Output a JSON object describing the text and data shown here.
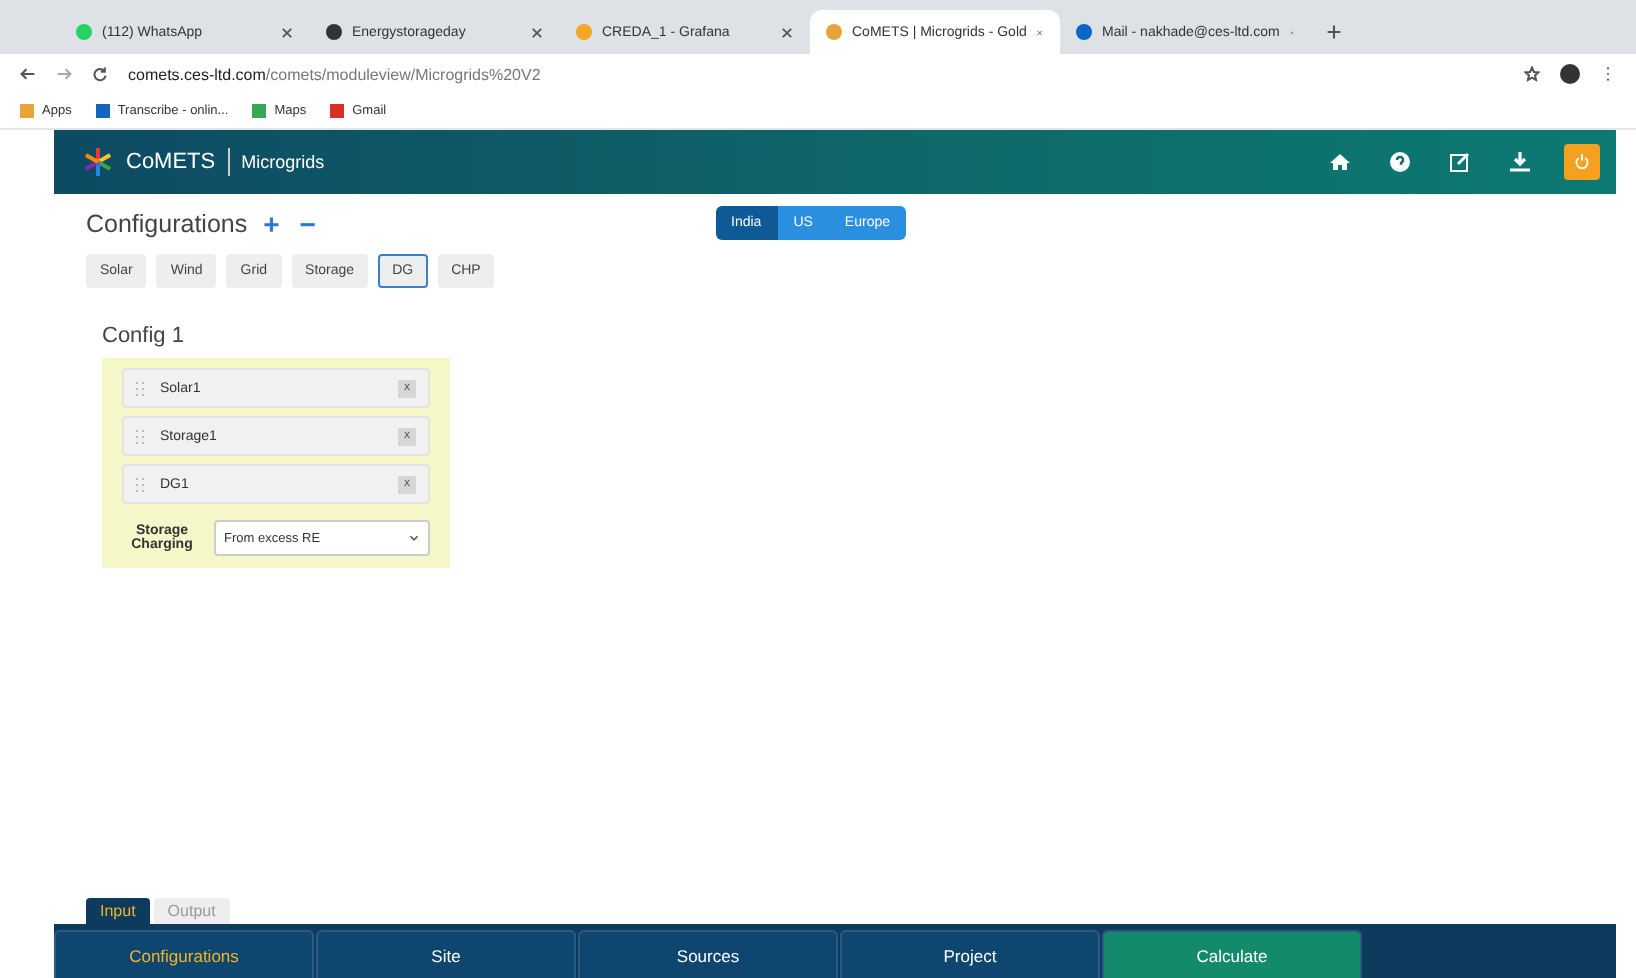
{
  "browser": {
    "tabs": [
      {
        "title": "(112) WhatsApp",
        "selected": false,
        "color": "#25d366"
      },
      {
        "title": "Energystorageday",
        "selected": false,
        "color": "#333333"
      },
      {
        "title": "CREDA_1 - Grafana",
        "selected": false,
        "color": "#f5a623"
      },
      {
        "title": "CoMETS | Microgrids - Gold",
        "selected": true,
        "color": "#e8a33a"
      },
      {
        "title": "Mail - nakhade@ces-ltd.com",
        "selected": false,
        "color": "#0a66c2"
      }
    ],
    "address": {
      "host": "comets.ces-ltd.com",
      "path": "/comets/moduleview/Microgrids%20V2"
    },
    "bookmarks": [
      {
        "label": "Apps",
        "color": "#e8a33a"
      },
      {
        "label": "Transcribe - onlin...",
        "color": "#1565c0"
      },
      {
        "label": "Maps",
        "color": "#34a853"
      },
      {
        "label": "Gmail",
        "color": "#d93025"
      }
    ]
  },
  "header": {
    "brand": "CoMETS",
    "product": "Microgrids"
  },
  "configurations": {
    "title": "Configurations",
    "add": "+",
    "remove": "−"
  },
  "regions": [
    {
      "label": "India",
      "selected": true
    },
    {
      "label": "US",
      "selected": false
    },
    {
      "label": "Europe",
      "selected": false
    }
  ],
  "components": [
    {
      "label": "Solar",
      "selected": false
    },
    {
      "label": "Wind",
      "selected": false
    },
    {
      "label": "Grid",
      "selected": false
    },
    {
      "label": "Storage",
      "selected": false
    },
    {
      "label": "DG",
      "selected": true
    },
    {
      "label": "CHP",
      "selected": false
    }
  ],
  "config": {
    "title": "Config 1",
    "items": [
      {
        "label": "Solar1",
        "remove": "x"
      },
      {
        "label": "Storage1",
        "remove": "x"
      },
      {
        "label": "DG1",
        "remove": "x"
      }
    ],
    "storage_label": "Storage Charging",
    "storage_value": "From excess RE"
  },
  "io_tabs": [
    {
      "label": "Input",
      "selected": true
    },
    {
      "label": "Output",
      "selected": false
    }
  ],
  "nav": [
    {
      "label": "Configurations",
      "selected": true,
      "kind": "tab"
    },
    {
      "label": "Site",
      "selected": false,
      "kind": "tab"
    },
    {
      "label": "Sources",
      "selected": false,
      "kind": "tab"
    },
    {
      "label": "Project",
      "selected": false,
      "kind": "tab"
    },
    {
      "label": "Calculate",
      "selected": false,
      "kind": "action"
    }
  ]
}
